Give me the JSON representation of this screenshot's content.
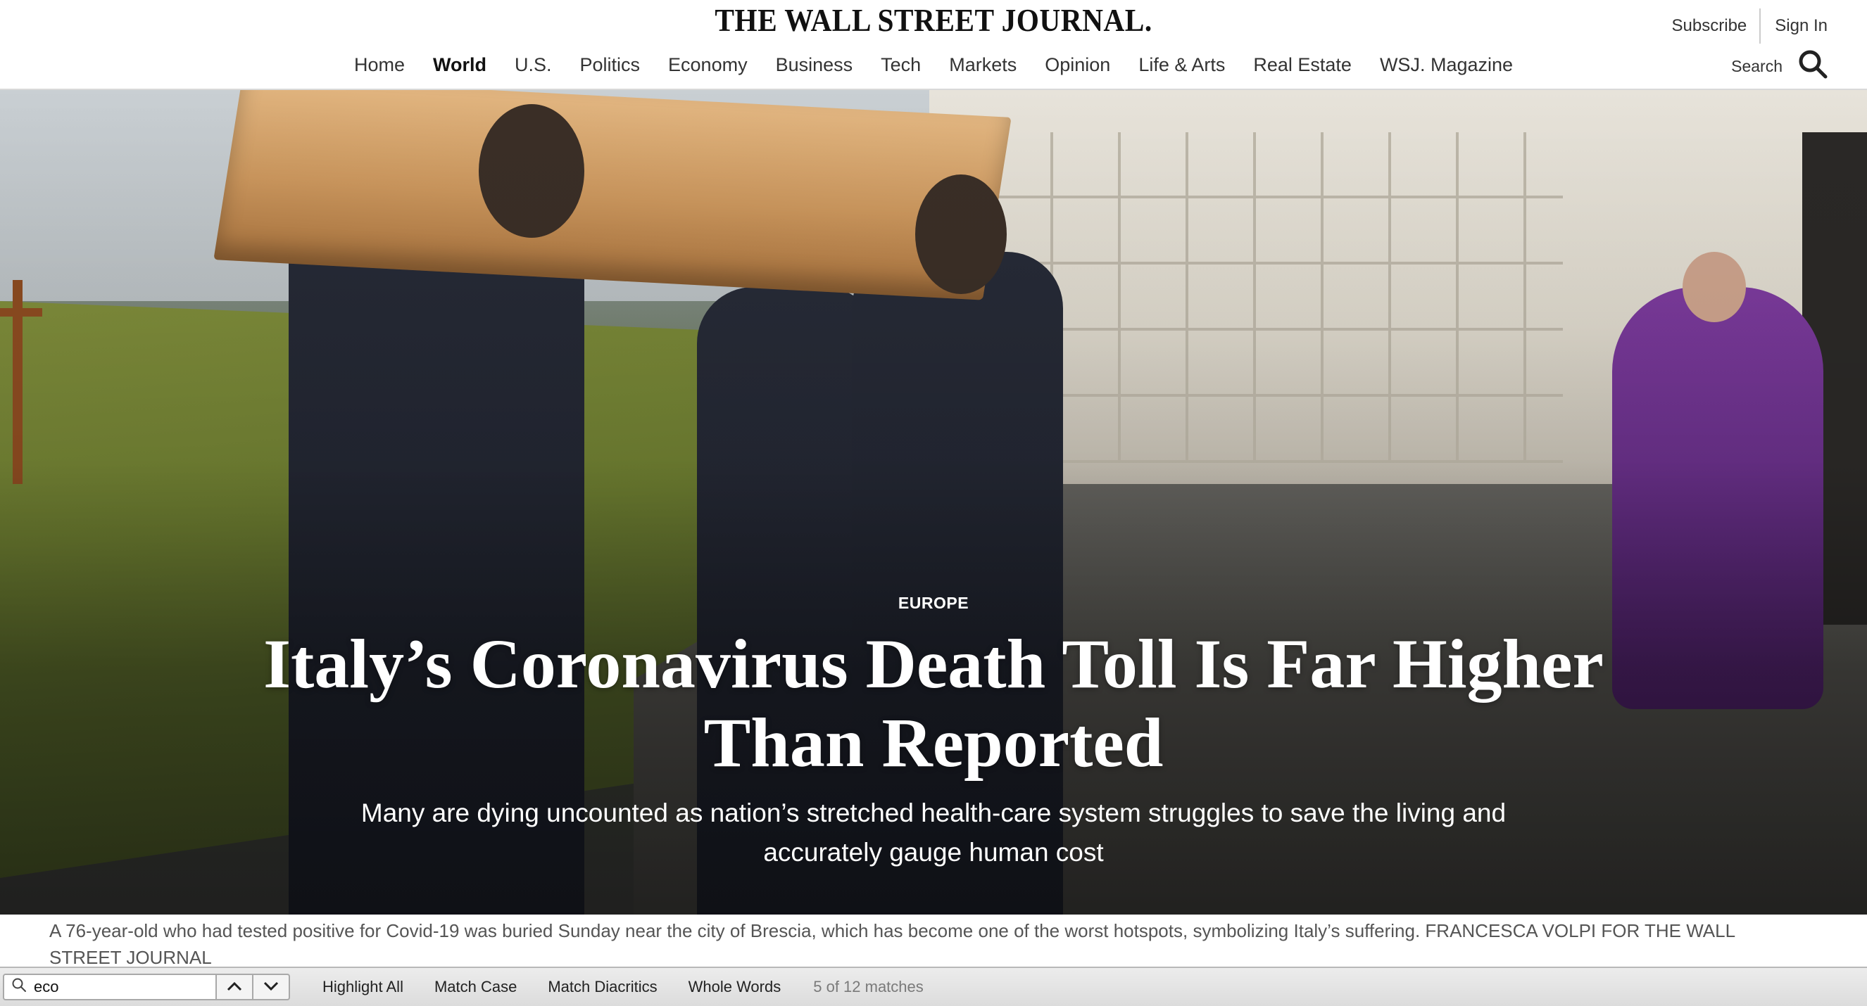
{
  "header": {
    "masthead": "THE WALL STREET JOURNAL.",
    "subscribe_label": "Subscribe",
    "signin_label": "Sign In",
    "search_label": "Search",
    "nav": [
      {
        "label": "Home",
        "active": false
      },
      {
        "label": "World",
        "active": true
      },
      {
        "label": "U.S.",
        "active": false
      },
      {
        "label": "Politics",
        "active": false
      },
      {
        "label": "Economy",
        "active": false
      },
      {
        "label": "Business",
        "active": false
      },
      {
        "label": "Tech",
        "active": false
      },
      {
        "label": "Markets",
        "active": false
      },
      {
        "label": "Opinion",
        "active": false
      },
      {
        "label": "Life & Arts",
        "active": false
      },
      {
        "label": "Real Estate",
        "active": false
      },
      {
        "label": "WSJ. Magazine",
        "active": false
      }
    ]
  },
  "article": {
    "flag": "EUROPE",
    "headline": "Italy’s Coronavirus Death Toll Is Far Higher Than Reported",
    "dek": "Many are dying uncounted as nation’s stretched health-care system struggles to save the living and accurately gauge human cost",
    "caption": "A 76-year-old who had tested positive for Covid-19 was buried Sunday near the city of Brescia, which has become one of the worst hotspots, symbolizing Italy’s suffering. FRANCESCA VOLPI FOR THE WALL STREET JOURNAL"
  },
  "findbar": {
    "query": "eco",
    "highlight_all": "Highlight All",
    "match_case": "Match Case",
    "match_diacritics": "Match Diacritics",
    "whole_words": "Whole Words",
    "match_count": "5 of 12 matches"
  },
  "icons": {
    "search": "search-icon",
    "find_search": "magnifier-icon",
    "prev": "chevron-up-icon",
    "next": "chevron-down-icon"
  }
}
